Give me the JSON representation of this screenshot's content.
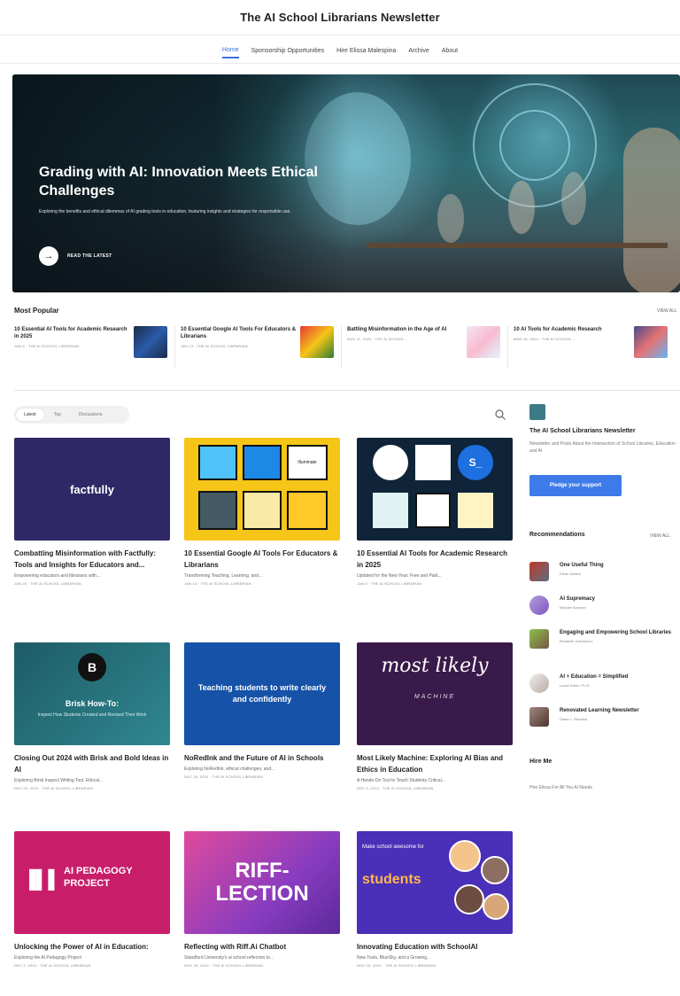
{
  "site": {
    "title": "The AI School Librarians Newsletter"
  },
  "nav": [
    "Home",
    "Sponsorship Opportunities",
    "Hire Elissa Malespina",
    "Archive",
    "About"
  ],
  "hero": {
    "title": "Grading with AI: Innovation Meets Ethical Challenges",
    "subtitle": "Exploring the benefits and ethical dilemmas of AI grading tools in education, featuring insights and strategies for responsible use.",
    "cta": "READ THE LATEST"
  },
  "popular": {
    "title": "Most Popular",
    "view_all": "VIEW ALL",
    "items": [
      {
        "title": "10 Essential AI Tools for Academic Research in 2025",
        "meta": "JAN 6 · THE AI SCHOOL LIBRARIAN"
      },
      {
        "title": "10 Essential Google AI Tools For Educators & Librarians",
        "meta": "JAN 13 · THE AI SCHOOL LIBRARIAN"
      },
      {
        "title": "Battling Misinformation in the Age of AI",
        "meta": "NOV 11, 2024 · THE AI SCHOOL..."
      },
      {
        "title": "10 AI Tools for Academic Research",
        "meta": "MAR 18, 2024 · THE AI SCHOOL..."
      }
    ]
  },
  "tabs": [
    "Latest",
    "Top",
    "Discussions"
  ],
  "posts": [
    {
      "title": "Combatting Misinformation with Factfully: Tools and Insights for Educators and...",
      "sub": "Empowering educators and librarians with...",
      "meta": "JAN 20 · THE AI SCHOOL LIBRARIAN",
      "img_text": "factfully",
      "img_tag": ""
    },
    {
      "title": "10 Essential Google AI Tools For Educators & Librarians",
      "sub": "Transforming Teaching, Learning, and...",
      "meta": "JAN 13 · THE AI SCHOOL LIBRARIAN",
      "img_text": "Illuminate",
      "img_tag": ""
    },
    {
      "title": "10 Essential AI Tools for Academic Research in 2025",
      "sub": "Updated for the New Year: Free and Paid...",
      "meta": "JAN 6 · THE AI SCHOOL LIBRARIAN",
      "img_text": "S_",
      "img_tag": ""
    },
    {
      "title": "Closing Out 2024 with Brisk and Bold Ideas in AI",
      "sub": "Exploring Brisk Inspect Writing Tool, Ethical...",
      "meta": "DEC 29, 2024 · THE AI SCHOOL LIBRARIAN",
      "img_text": "Brisk How-To:",
      "img_tag": "Inspect How Students Created and Revised Their Work"
    },
    {
      "title": "NoRedInk and the Future of AI in Schools",
      "sub": "Exploring NoRedInk, ethical challenges, and...",
      "meta": "DEC 16, 2024 · THE AI SCHOOL LIBRARIAN",
      "img_text": "Teaching students to write clearly and confidently",
      "img_tag": ""
    },
    {
      "title": "Most Likely Machine: Exploring AI Bias and Ethics in Education",
      "sub": "A Hands-On Tool to Teach Students Critical...",
      "meta": "DEC 9, 2024 · THE AI SCHOOL LIBRARIAN",
      "img_text": "most likely",
      "img_tag": "MACHINE"
    },
    {
      "title": "Unlocking the Power of AI in Education:",
      "sub": "Exploring the AI Pedagogy Project",
      "meta": "DEC 2, 2024 · THE AI SCHOOL LIBRARIAN",
      "img_text": "AI PEDAGOGY PROJECT",
      "img_tag": ""
    },
    {
      "title": "Reflecting with Riff.Ai Chatbot",
      "sub": "Standford University's ai school reflection to...",
      "meta": "NOV 25, 2024 · THE AI SCHOOL LIBRARIAN",
      "img_text": "RIFF- LECTION",
      "img_tag": ""
    },
    {
      "title": "Innovating Education with SchoolAI",
      "sub": "New Tools, BlueSky, and a Growing...",
      "meta": "NOV 18, 2024 · THE AI SCHOOL LIBRARIAN",
      "img_text": "students",
      "img_tag": "Make school awesome for"
    }
  ],
  "sidebar": {
    "name": "The AI School Librarians Newsletter",
    "desc": "Newsletter and Posts About the Intersection of School Libraries, Education and AI",
    "pledge": "Pledge your support",
    "rec_title": "Recommendations",
    "rec_view_all": "VIEW ALL",
    "recs": [
      {
        "name": "One Useful Thing",
        "author": "Ethan Mollick"
      },
      {
        "name": "AI Supremacy",
        "author": "Michael Spencer"
      },
      {
        "name": "Engaging and Empowering School Libraries",
        "author": "Elizabeth Hutchinson"
      },
      {
        "name": "AI + Education = Simplified",
        "author": "Lance Eaton, Ph.D."
      },
      {
        "name": "Renovated Learning Newsletter",
        "author": "Diana L. Rendina"
      }
    ],
    "hire_title": "Hire Me",
    "hire_text": "Hire Elissa For All You AI Needs"
  },
  "colors": {
    "accent": "#3d7be8",
    "nav_active": "#3d6fd8"
  }
}
